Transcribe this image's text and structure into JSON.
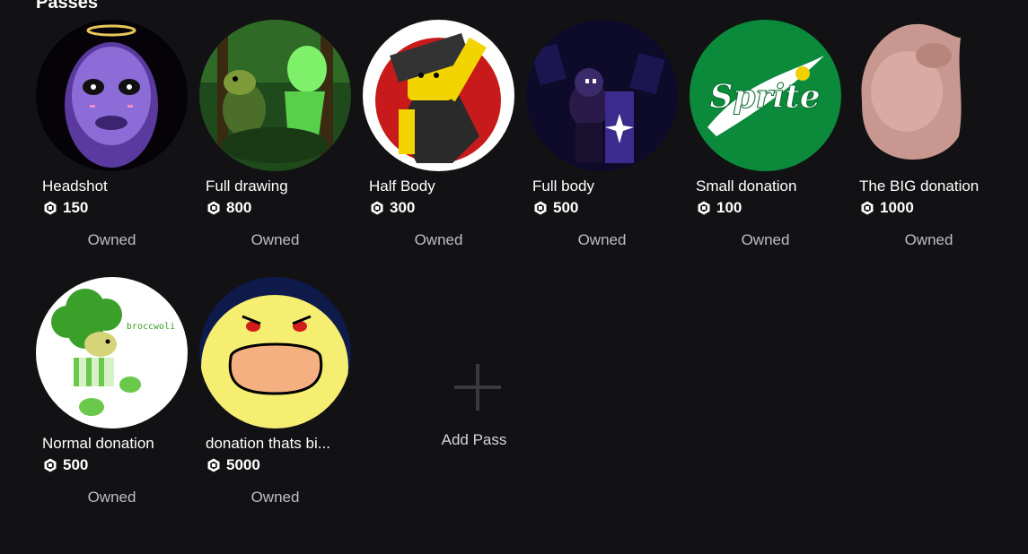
{
  "section": {
    "title": "Passes"
  },
  "passes": [
    {
      "name": "Headshot",
      "price": "150",
      "status": "Owned",
      "image": "purple-face-art"
    },
    {
      "name": "Full drawing",
      "price": "800",
      "status": "Owned",
      "image": "green-forest-characters-art"
    },
    {
      "name": "Half Body",
      "price": "300",
      "status": "Owned",
      "image": "yellow-character-red-background-art"
    },
    {
      "name": "Full body",
      "price": "500",
      "status": "Owned",
      "image": "dark-purple-character-art"
    },
    {
      "name": "Small donation",
      "price": "100",
      "status": "Owned",
      "image": "sprite-logo"
    },
    {
      "name": "The BIG donation",
      "price": "1000",
      "status": "Owned",
      "image": "pink-blob-photo"
    },
    {
      "name": "Normal donation",
      "price": "500",
      "status": "Owned",
      "image": "broccwoli-character-art",
      "image_caption": "broccwoli"
    },
    {
      "name": "donation thats bi...",
      "price": "5000",
      "status": "Owned",
      "image": "yellow-shouting-face-art"
    }
  ],
  "add_pass": {
    "label": "Add Pass"
  },
  "colors": {
    "background": "#121215",
    "text_primary": "#ffffff",
    "text_secondary": "#bdbec1",
    "sprite_green": "#0a8a3a"
  }
}
